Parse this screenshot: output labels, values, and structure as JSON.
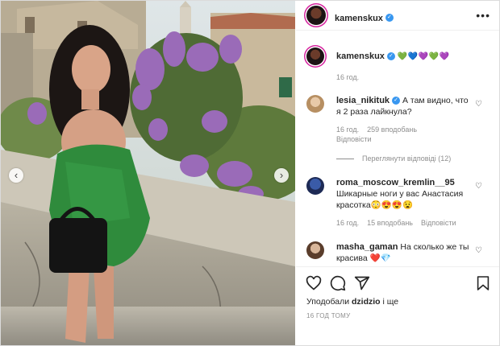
{
  "post": {
    "username": "kamenskux",
    "caption_emojis": "💚💙💜💚💜",
    "caption_time": "16 год.",
    "liked_by_prefix": "Уподобали",
    "liked_by_user": "dzidzio",
    "liked_by_suffix": "і ще",
    "time_ago": "16 ГОД ТОМУ"
  },
  "comments": [
    {
      "username": "lesia_nikituk",
      "text": "А там видно, что я 2 раза лайкнула?",
      "time": "16 год.",
      "likes": "259 вподобань",
      "reply": "Відповісти",
      "view_replies": "Переглянути відповіді (12)"
    },
    {
      "username": "roma_moscow_kremlin__95",
      "text": "Шикарные ноги у вас Анастасия красотка😳😍😍😧",
      "time": "16 год.",
      "likes": "15 вподобань",
      "reply": "Відповісти"
    },
    {
      "username": "masha_gaman",
      "text": "На сколько же ты красива",
      "emoji": "❤️💎"
    }
  ],
  "colors": {
    "verified": "#3897f0",
    "meta": "#8e8e8e",
    "story_ring": "#d6249f"
  },
  "icons": [
    "more-icon",
    "verified-icon",
    "heart-icon",
    "comment-icon",
    "share-icon",
    "bookmark-icon",
    "chevron-left-icon",
    "chevron-right-icon"
  ]
}
